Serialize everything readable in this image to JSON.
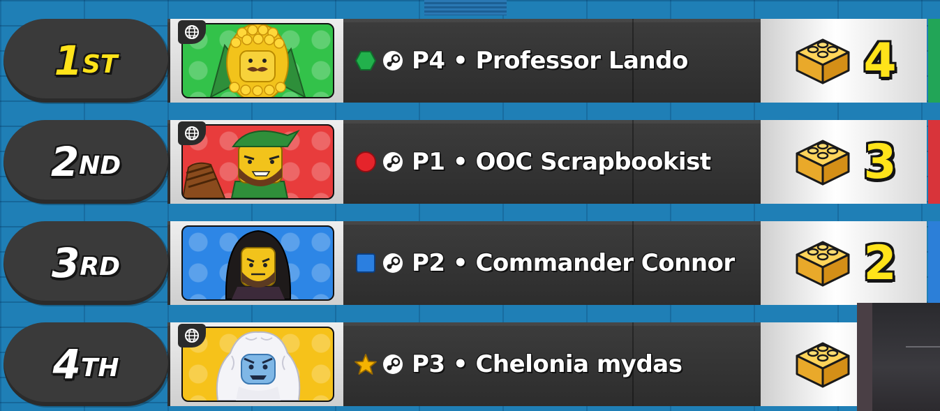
{
  "standings": [
    {
      "rank_num": "1",
      "rank_suffix": "ST",
      "rank_color": "#ffe31a",
      "online": true,
      "team_icon": "green-hexagon-icon",
      "team_color": "#22b14c",
      "player": "P4 • Professor Lando",
      "character": "corn-costume-minifig",
      "portrait_bg": "#33c24a",
      "score": "4"
    },
    {
      "rank_num": "2",
      "rank_suffix": "ND",
      "rank_color": "#ffffff",
      "online": true,
      "team_icon": "red-circle-icon",
      "team_color": "#e5242b",
      "player": "P1 • OOC Scrapbookist",
      "character": "robin-hood-archer-minifig",
      "portrait_bg": "#e83c3c",
      "score": "3"
    },
    {
      "rank_num": "3",
      "rank_suffix": "RD",
      "rank_color": "#ffffff",
      "online": false,
      "team_icon": "blue-square-icon",
      "team_color": "#2b7fe0",
      "player": "P2 • Commander Connor",
      "character": "long-haired-warrior-minifig",
      "portrait_bg": "#2d86e6",
      "score": "2"
    },
    {
      "rank_num": "4",
      "rank_suffix": "TH",
      "rank_color": "#ffffff",
      "online": true,
      "team_icon": "yellow-star-icon",
      "team_color": "#f5b301",
      "player": "P3 • Chelonia mydas",
      "character": "yeti-minifig",
      "portrait_bg": "#f6c21a",
      "score": ""
    }
  ]
}
